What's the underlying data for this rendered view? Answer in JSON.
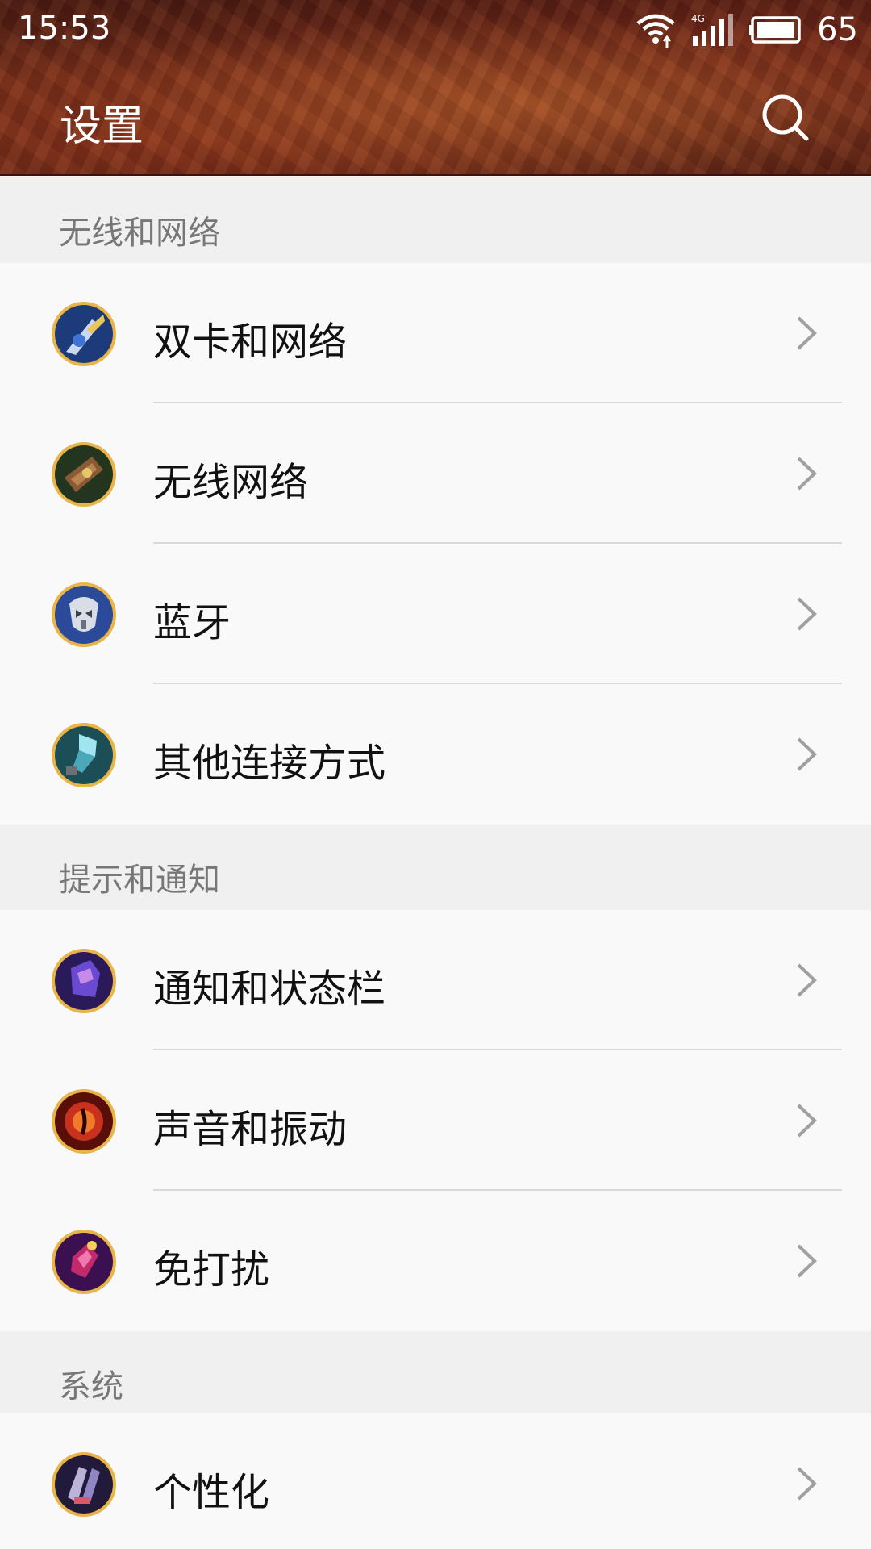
{
  "status": {
    "time": "15:53",
    "network": "4G",
    "battery": "65"
  },
  "header": {
    "title": "设置"
  },
  "sections": [
    {
      "title": "无线和网络",
      "items": [
        {
          "label": "双卡和网络",
          "icon": "dual-sim-icon"
        },
        {
          "label": "无线网络",
          "icon": "wifi-network-icon"
        },
        {
          "label": "蓝牙",
          "icon": "bluetooth-icon"
        },
        {
          "label": "其他连接方式",
          "icon": "other-connections-icon"
        }
      ]
    },
    {
      "title": "提示和通知",
      "items": [
        {
          "label": "通知和状态栏",
          "icon": "notification-icon"
        },
        {
          "label": "声音和振动",
          "icon": "sound-icon"
        },
        {
          "label": "免打扰",
          "icon": "do-not-disturb-icon"
        }
      ]
    },
    {
      "title": "系统",
      "items": [
        {
          "label": "个性化",
          "icon": "personalization-icon"
        }
      ]
    }
  ],
  "colors": {
    "header_bg": "#5a2014",
    "list_bg": "#f9f9f9",
    "section_bg": "#f1f0f0",
    "section_text": "#777777",
    "icon_ring": "#d49a2a",
    "chevron": "#a0a0a0"
  }
}
